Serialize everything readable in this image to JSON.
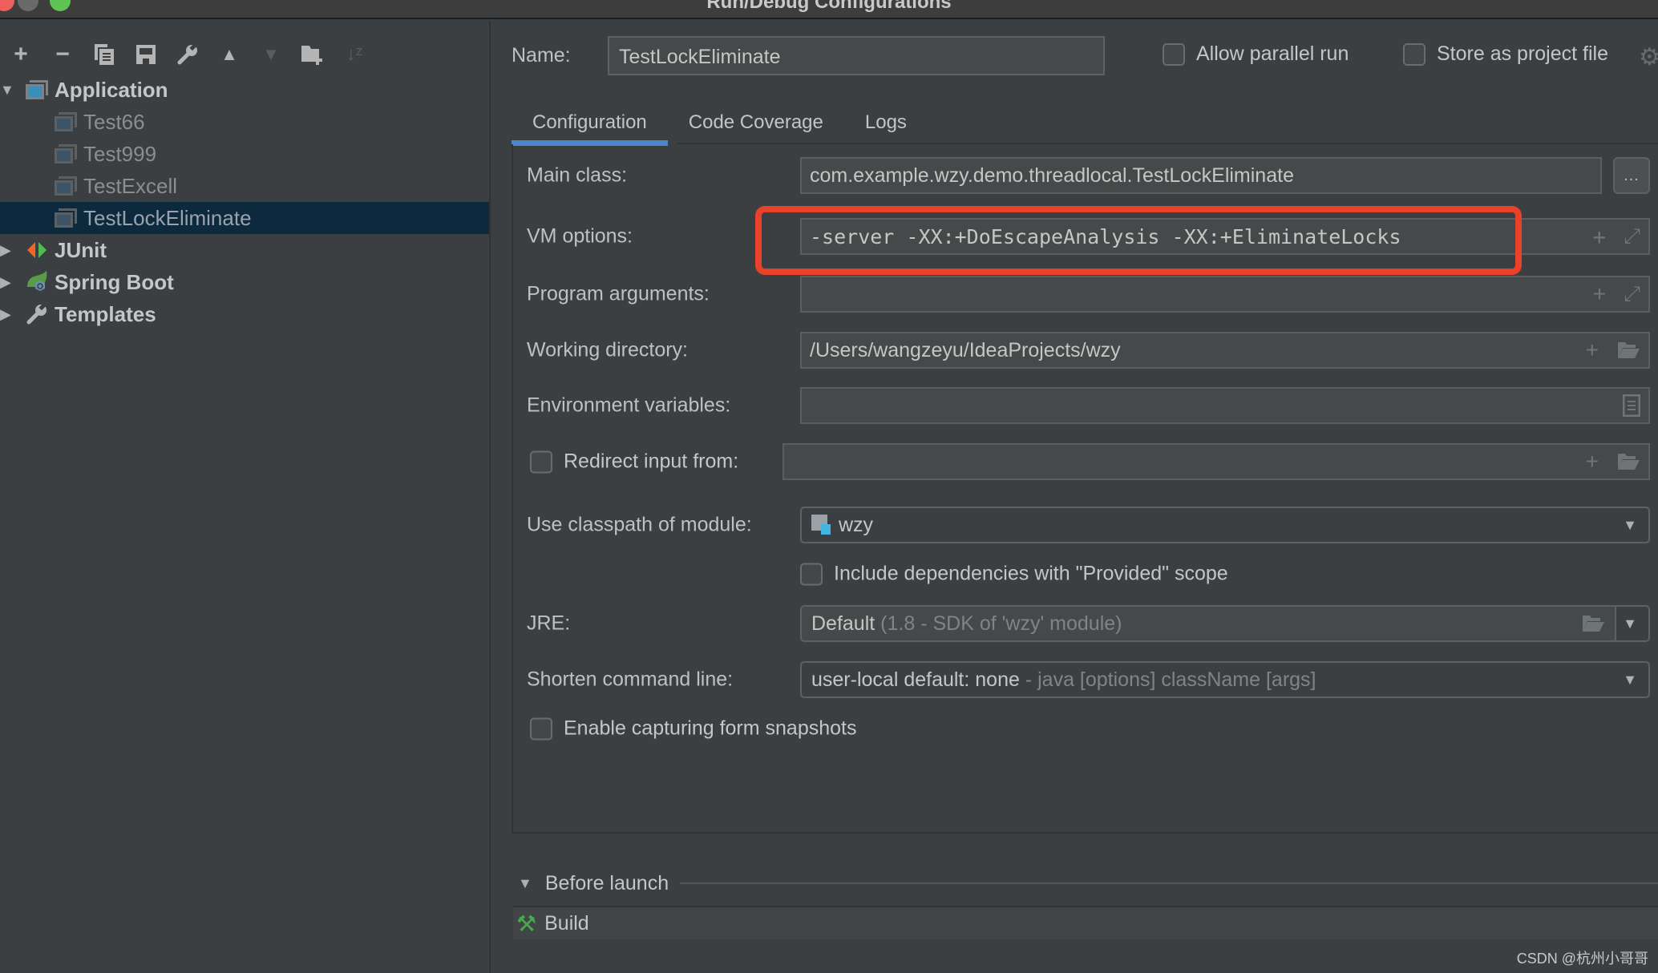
{
  "window": {
    "title": "Run/Debug Configurations"
  },
  "toolbar": {
    "buttons": [
      {
        "name": "add",
        "icon": "plus-icon",
        "glyph": "+"
      },
      {
        "name": "remove",
        "icon": "minus-icon",
        "glyph": "−"
      },
      {
        "name": "copy",
        "icon": "copy-icon",
        "glyph": "⧉"
      },
      {
        "name": "save",
        "icon": "save-icon",
        "glyph": "💾"
      },
      {
        "name": "edit-defaults",
        "icon": "wrench-icon",
        "glyph": "🔧"
      },
      {
        "name": "move-up",
        "icon": "arrow-up-icon",
        "glyph": "▲"
      },
      {
        "name": "move-down",
        "icon": "arrow-down-icon",
        "glyph": "▼"
      },
      {
        "name": "new-folder",
        "icon": "folder-add-icon",
        "glyph": "📁"
      },
      {
        "name": "sort",
        "icon": "sort-alpha-icon",
        "glyph": "⇣"
      }
    ]
  },
  "tree": {
    "groups": [
      {
        "label": "Application",
        "expanded": true,
        "icon": "application-icon",
        "children": [
          {
            "label": "Test66"
          },
          {
            "label": "Test999"
          },
          {
            "label": "TestExcell"
          },
          {
            "label": "TestLockEliminate",
            "selected": true
          }
        ]
      },
      {
        "label": "JUnit",
        "expanded": false,
        "icon": "junit-icon"
      },
      {
        "label": "Spring Boot",
        "expanded": false,
        "icon": "spring-boot-icon"
      },
      {
        "label": "Templates",
        "expanded": false,
        "icon": "wrench-icon"
      }
    ]
  },
  "header": {
    "name_label": "Name:",
    "name_value": "TestLockEliminate",
    "allow_parallel_label": "Allow parallel run",
    "allow_parallel_checked": false,
    "store_project_label": "Store as project file",
    "store_project_checked": false
  },
  "tabs": [
    {
      "label": "Configuration",
      "active": true
    },
    {
      "label": "Code Coverage",
      "active": false
    },
    {
      "label": "Logs",
      "active": false
    }
  ],
  "form": {
    "main_class_label": "Main class:",
    "main_class_value": "com.example.wzy.demo.threadlocal.TestLockEliminate",
    "main_class_button": "...",
    "vm_options_label": "VM options:",
    "vm_options_value": "-server -XX:+DoEscapeAnalysis -XX:+EliminateLocks",
    "program_args_label": "Program arguments:",
    "program_args_value": "",
    "working_dir_label": "Working directory:",
    "working_dir_value": "/Users/wangzeyu/IdeaProjects/wzy",
    "env_vars_label": "Environment variables:",
    "env_vars_value": "",
    "redirect_label": "Redirect input from:",
    "redirect_checked": false,
    "redirect_value": "",
    "classpath_label": "Use classpath of module:",
    "classpath_value": "wzy",
    "include_provided_label": "Include dependencies with \"Provided\" scope",
    "include_provided_checked": false,
    "jre_label": "JRE:",
    "jre_value": "Default",
    "jre_hint": "(1.8 - SDK of 'wzy' module)",
    "shorten_label": "Shorten command line:",
    "shorten_value": "user-local default: none",
    "shorten_hint": "- java [options] className [args]",
    "enable_snapshots_label": "Enable capturing form snapshots",
    "enable_snapshots_checked": false
  },
  "before_launch": {
    "title": "Before launch",
    "tasks": [
      {
        "label": "Build",
        "icon": "hammer-icon"
      }
    ]
  },
  "annotation": {
    "highlight_color": "#e9412a",
    "highlighted_field": "vm_options"
  },
  "watermark": "CSDN @杭州小哥哥"
}
